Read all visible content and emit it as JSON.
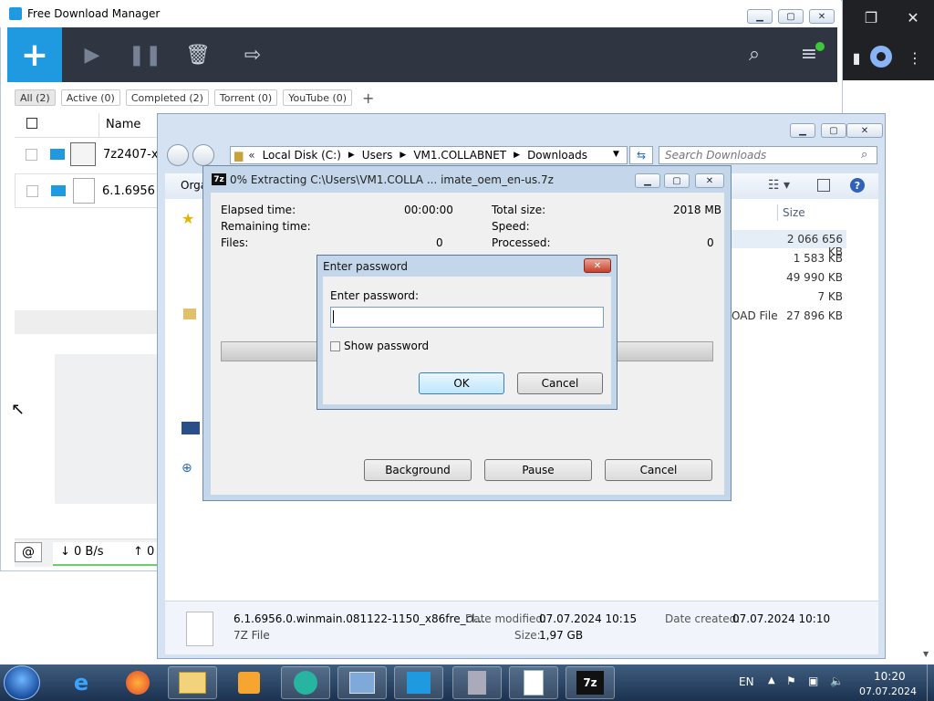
{
  "browser": {
    "restore_icon": "❐",
    "close_icon": "✕",
    "extension_icon": "▮",
    "profile_icon": "●",
    "menu_icon": "⋮"
  },
  "fdm": {
    "title": "Free Download Manager",
    "add_icon": "+",
    "filters": [
      "All (2)",
      "Active (0)",
      "Completed (2)",
      "Torrent (0)",
      "YouTube (0)"
    ],
    "add_filter_icon": "+",
    "column_name": "Name",
    "rows": [
      {
        "name": "7z2407-x"
      },
      {
        "name": "6.1.6956"
      }
    ],
    "speed_down": "↓ 0 B/s",
    "speed_up": "↑ 0"
  },
  "explorer": {
    "breadcrumb": [
      "Local Disk (C:)",
      "Users",
      "VM1.COLLABNET",
      "Downloads"
    ],
    "search_placeholder": "Search Downloads",
    "organize_label": "Orga",
    "size_header": "Size",
    "sizes": [
      "2 066 656 KB",
      "1 583 KB",
      "49 990 KB",
      "7 KB",
      "27 896 KB"
    ],
    "type_fragment": "OAD File",
    "details": {
      "file_name": "6.1.6956.0.winmain.081122-1150_x86fre_cl...",
      "file_type": "7Z File",
      "date_modified_label": "Date modified:",
      "date_modified": "07.07.2024 10:15",
      "size_label": "Size:",
      "size": "1,97 GB",
      "date_created_label": "Date created:",
      "date_created": "07.07.2024 10:10"
    }
  },
  "zip": {
    "title": "0% Extracting C:\\Users\\VM1.COLLA ... imate_oem_en-us.7z",
    "app_icon": "7z",
    "elapsed_label": "Elapsed time:",
    "elapsed_value": "00:00:00",
    "remaining_label": "Remaining time:",
    "files_label": "Files:",
    "files_value": "0",
    "total_size_label": "Total size:",
    "total_size_value": "2018 MB",
    "speed_label": "Speed:",
    "processed_label": "Processed:",
    "processed_value": "0",
    "progress": 0,
    "background_button": "Background",
    "pause_button": "Pause",
    "cancel_button": "Cancel"
  },
  "password": {
    "title": "Enter password",
    "prompt": "Enter password:",
    "value": "",
    "show_password_label": "Show password",
    "show_password_checked": false,
    "ok_button": "OK",
    "cancel_button": "Cancel",
    "close_icon": "✕"
  },
  "taskbar": {
    "language": "EN",
    "time": "10:20",
    "date": "07.07.2024",
    "start_icon": "start-orb",
    "items": [
      "internet-explorer-icon",
      "firefox-icon",
      "file-explorer-icon",
      "media-player-icon",
      "chat-icon",
      "control-panel-icon",
      "fdm-icon",
      "recycle-icon",
      "document-icon",
      "7zip-icon"
    ]
  }
}
